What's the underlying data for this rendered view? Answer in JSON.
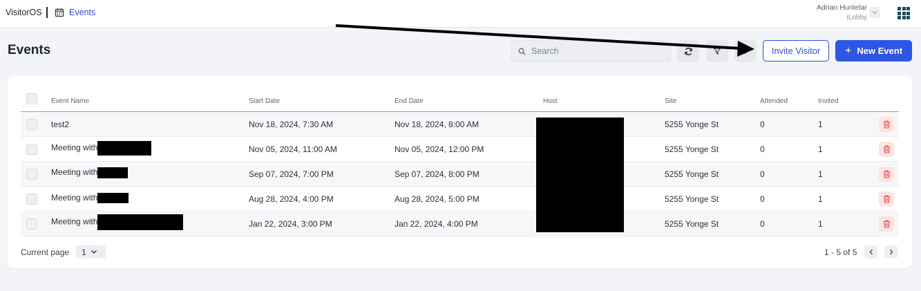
{
  "topbar": {
    "brand": "VisitorOS",
    "breadcrumb": "Events",
    "user_name": "Adrian Huntelar",
    "user_site": "iLobby"
  },
  "header": {
    "title": "Events",
    "search_placeholder": "Search",
    "invite_label": "Invite Visitor",
    "new_event_label": "New Event",
    "new_event_icon": "plus-icon"
  },
  "table": {
    "columns": [
      "Event Name",
      "Start Date",
      "End Date",
      "Host",
      "Site",
      "Attended",
      "Invited"
    ],
    "rows": [
      {
        "name": "test2",
        "start": "Nov 18, 2024, 7:30 AM",
        "end": "Nov 18, 2024, 8:00 AM",
        "site": "5255 Yonge St",
        "attended": "0",
        "invited": "1"
      },
      {
        "name": "Meeting with",
        "start": "Nov 05, 2024, 11:00 AM",
        "end": "Nov 05, 2024, 12:00 PM",
        "site": "5255 Yonge St",
        "attended": "0",
        "invited": "1"
      },
      {
        "name": "Meeting with",
        "start": "Sep 07, 2024, 7:00 PM",
        "end": "Sep 07, 2024, 8:00 PM",
        "site": "5255 Yonge St",
        "attended": "0",
        "invited": "1"
      },
      {
        "name": "Meeting with",
        "start": "Aug 28, 2024, 4:00 PM",
        "end": "Aug 28, 2024, 5:00 PM",
        "site": "5255 Yonge St",
        "attended": "0",
        "invited": "1"
      },
      {
        "name": "Meeting with",
        "start": "Jan 22, 2024, 3:00 PM",
        "end": "Jan 22, 2024, 4:00 PM",
        "site": "5255 Yonge St",
        "attended": "0",
        "invited": "1"
      }
    ]
  },
  "footer": {
    "current_page_label": "Current page",
    "current_page": "1",
    "range": "1 - 5 of 5"
  },
  "colors": {
    "accent": "#2f55e4",
    "danger": "#e5484d",
    "danger_bg": "#fde3e1"
  }
}
